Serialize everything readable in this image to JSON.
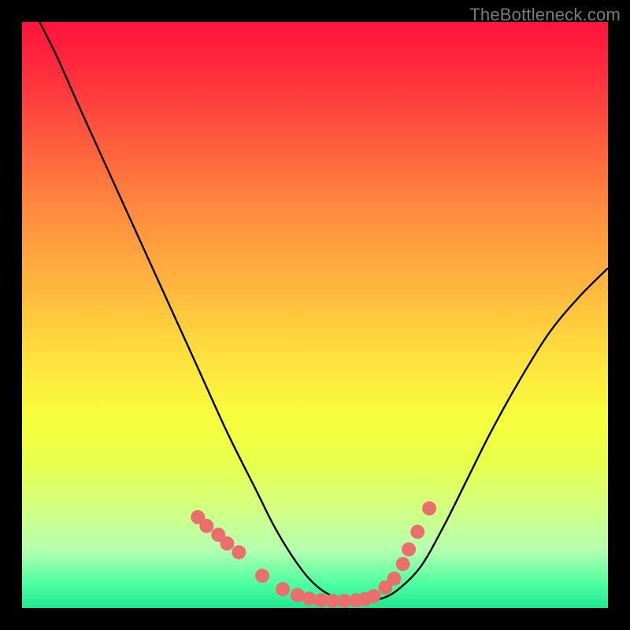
{
  "watermark": "TheBottleneck.com",
  "colors": {
    "curve_stroke": "#000000",
    "marker_fill": "#e96f6d",
    "marker_stroke": "#d85b5a"
  },
  "chart_data": {
    "type": "line",
    "title": "",
    "xlabel": "",
    "ylabel": "",
    "xlim": [
      0,
      100
    ],
    "ylim": [
      0,
      100
    ],
    "series": [
      {
        "name": "bottleneck-curve",
        "x": [
          3,
          6,
          10,
          15,
          20,
          25,
          30,
          35,
          40,
          43,
          46,
          49,
          52,
          55,
          58,
          61,
          64,
          68,
          72,
          76,
          80,
          85,
          90,
          95,
          100
        ],
        "y": [
          100,
          94,
          85,
          74,
          63,
          52,
          41,
          30,
          20,
          14,
          9,
          5,
          2.5,
          1.5,
          1.2,
          1.5,
          3,
          7,
          14,
          22,
          30,
          39,
          47,
          53,
          58
        ]
      }
    ],
    "markers": {
      "name": "highlighted-points",
      "x": [
        30,
        31.5,
        33.5,
        35,
        37,
        41,
        44.5,
        47,
        49,
        51,
        53,
        55,
        57,
        58.5,
        60,
        62,
        63.5,
        65,
        66,
        67.5,
        69.5
      ],
      "y": [
        15.5,
        14,
        12.5,
        11,
        9.5,
        5.5,
        3.2,
        2.2,
        1.6,
        1.3,
        1.2,
        1.2,
        1.3,
        1.5,
        2.0,
        3.5,
        5,
        7.5,
        10,
        13,
        17
      ]
    }
  }
}
